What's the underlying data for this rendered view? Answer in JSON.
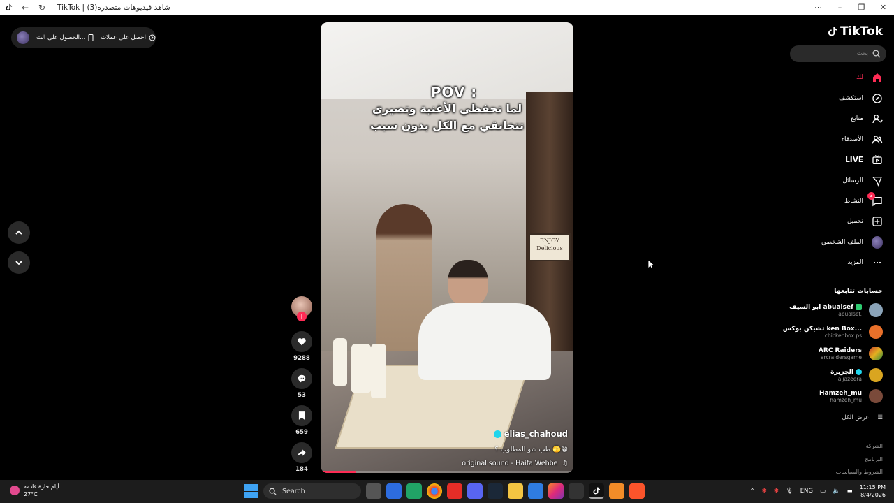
{
  "window": {
    "title": "TikTok | شاهد فيديوهات متصدرة(3)"
  },
  "topbar": {
    "get_coins": "احصل على عملات",
    "get_app": "الحصول على الت..."
  },
  "video": {
    "overlay_pov": "POV :",
    "overlay_line1": "لما تحفظي الأغنية وتصيري",
    "overlay_line2": "تتخانقي مع الكل بدون سبب",
    "sign_text": "ENJOY",
    "sign_text2": "Delicious",
    "author": "elias_chahoud",
    "caption": "طب شو المطلوب ؟ 🫣😁",
    "sound": "original sound - Haifa Wehbe",
    "progress": 0.14
  },
  "actions": {
    "likes": "9288",
    "comments": "53",
    "saves": "659",
    "shares": "184"
  },
  "sidebar": {
    "logo_text": "TikTok",
    "search_placeholder": "بحث",
    "menu": [
      {
        "label": "لك",
        "icon": "home-icon",
        "active": true
      },
      {
        "label": "استكشف",
        "icon": "compass-icon"
      },
      {
        "label": "متابَع",
        "icon": "user-follow-icon"
      },
      {
        "label": "الأصدقاء",
        "icon": "friends-icon"
      },
      {
        "label": "LIVE",
        "icon": "live-icon"
      },
      {
        "label": "الرسائل",
        "icon": "send-icon"
      },
      {
        "label": "النشاط",
        "icon": "inbox-icon",
        "badge": "3"
      },
      {
        "label": "تحميل",
        "icon": "upload-icon"
      },
      {
        "label": "الملف الشخصي",
        "icon": "avatar"
      },
      {
        "label": "المزيد",
        "icon": "more-icon"
      }
    ],
    "following_title": "حسابات تتابعها",
    "accounts": [
      {
        "name": "ابو السيف abualsef",
        "handle": "abualsef.",
        "color": "#8aa3b8"
      },
      {
        "name": "تشيكن بوكس Chicken Box",
        "name_display": "تشيكن بوكس ken Box...",
        "handle": "chickenbox.ps",
        "color": "#e8702a"
      },
      {
        "name": "ARC Raiders",
        "handle": "arcraidersgame",
        "color": "#2a2a2a"
      },
      {
        "name": "الجزيرة",
        "handle": "aljazeera",
        "color": "#d9a520"
      },
      {
        "name": "Hamzeh_mu",
        "handle": "hamzeh_mu",
        "color": "#7a4a3a"
      }
    ],
    "see_all": "عرض الكل",
    "footer": [
      "الشركة",
      "البرنامج",
      "الشروط والسياسات"
    ]
  },
  "taskbar": {
    "weather_title": "أيام حارة قادمة",
    "weather_temp": "27°C",
    "search_label": "Search",
    "lang": "ENG",
    "time": "11:15 PM",
    "date": "8/4/2026"
  },
  "colors": {
    "accent": "#fe2c55",
    "verified": "#20d5ec"
  }
}
